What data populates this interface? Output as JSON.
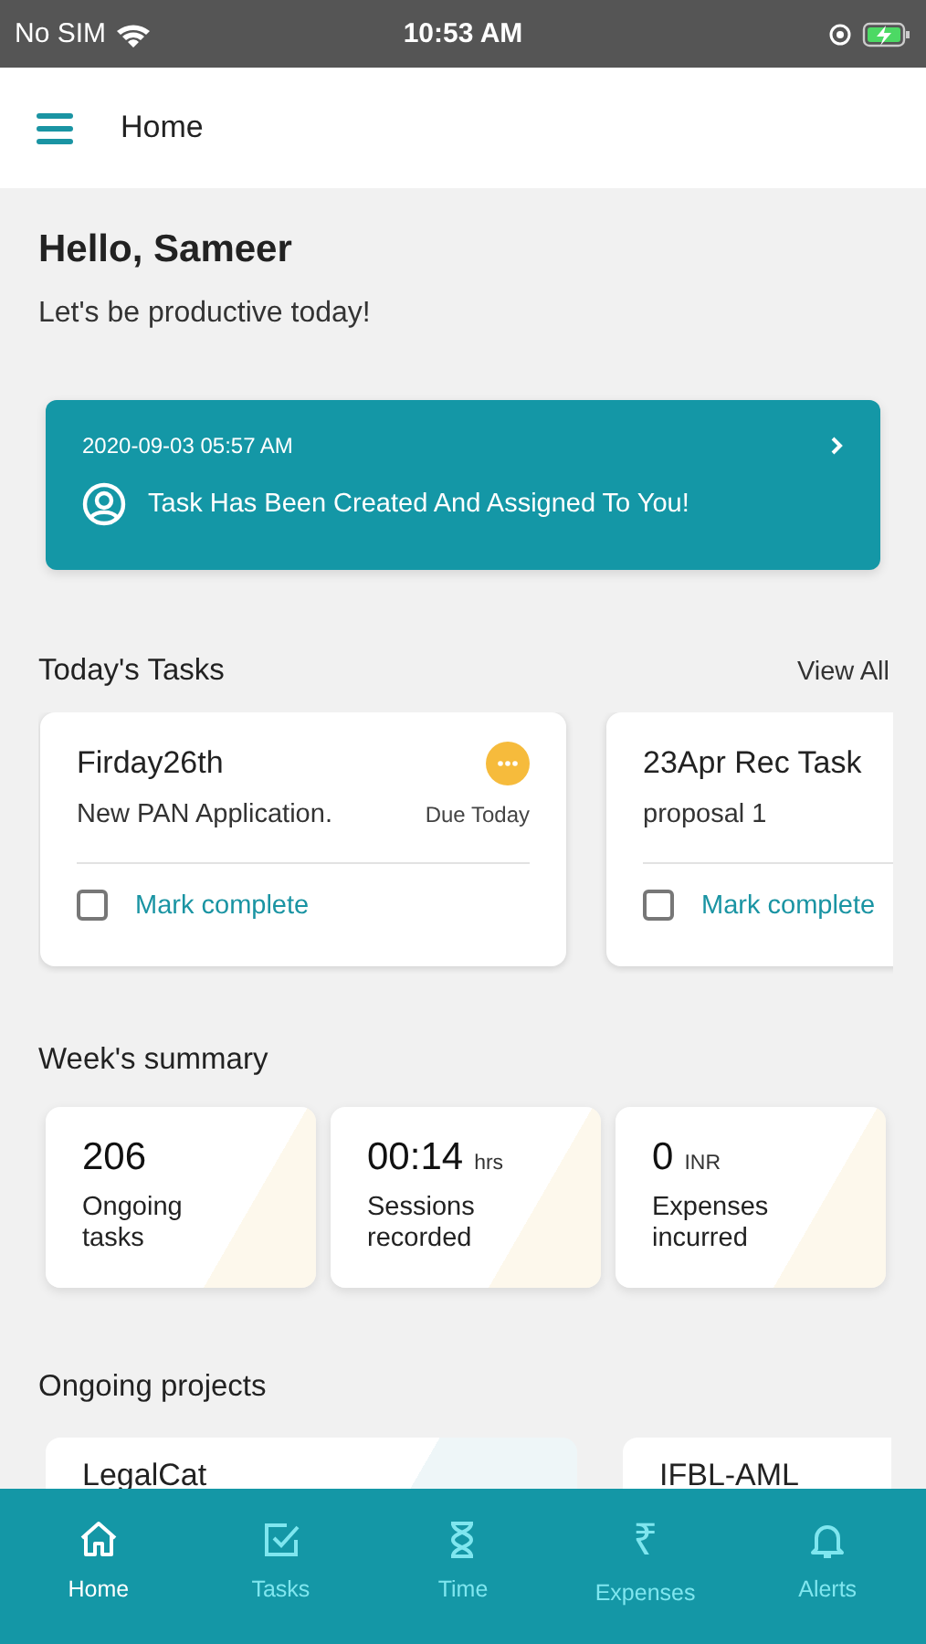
{
  "status_bar": {
    "carrier": "No SIM",
    "time": "10:53 AM"
  },
  "header": {
    "title": "Home"
  },
  "greeting": {
    "title": "Hello, Sameer",
    "subtitle": "Let's be productive today!"
  },
  "notification": {
    "timestamp": "2020-09-03 05:57 AM",
    "message": "Task Has Been Created And Assigned To You!"
  },
  "todays_tasks": {
    "title": "Today's Tasks",
    "action": "View All",
    "tasks": [
      {
        "title": "Firday26th",
        "subtitle": "New PAN Application.",
        "due": "Due Today",
        "menu": true,
        "checked": false,
        "action": "Mark complete"
      },
      {
        "title": "23Apr Rec Task",
        "subtitle": "proposal 1",
        "checked": false,
        "action": "Mark complete"
      }
    ]
  },
  "weeks_summary": {
    "title": "Week's summary",
    "items": [
      {
        "value": "206",
        "label": "Ongoing tasks"
      },
      {
        "value": "00:14",
        "unit": "hrs",
        "label": "Sessions recorded"
      },
      {
        "value": "0",
        "unit": "INR",
        "label": "Expenses incurred"
      }
    ]
  },
  "ongoing_projects": {
    "title": "Ongoing projects",
    "projects": [
      {
        "name": "LegalCat"
      },
      {
        "name": "IFBL-AML"
      }
    ]
  },
  "tab_bar": [
    {
      "label": "Home",
      "selected": true
    },
    {
      "label": "Tasks",
      "selected": false
    },
    {
      "label": "Time",
      "selected": false
    },
    {
      "label": "Expenses",
      "glyph": "₹",
      "selected": false
    },
    {
      "label": "Alerts",
      "selected": false
    }
  ]
}
